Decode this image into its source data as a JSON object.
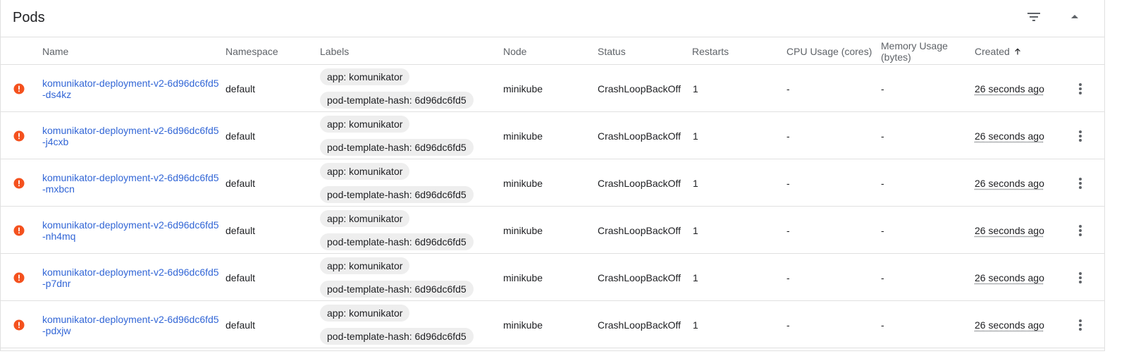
{
  "card": {
    "title": "Pods"
  },
  "header_icons": {
    "filter": "filter-list-icon",
    "collapse": "expand-less-icon"
  },
  "columns": {
    "name": "Name",
    "namespace": "Namespace",
    "labels": "Labels",
    "node": "Node",
    "status": "Status",
    "restarts": "Restarts",
    "cpu": "CPU Usage (cores)",
    "memory": "Memory Usage (bytes)",
    "created": "Created",
    "created_sort": "ascending"
  },
  "colors": {
    "error": "#f4511e",
    "link": "#3266d6",
    "chip_bg": "#eeeeee"
  },
  "rows": [
    {
      "status_icon": "error-icon",
      "name": "komunikator-deployment-v2-6d96dc6fd5-ds4kz",
      "namespace": "default",
      "labels": [
        "app: komunikator",
        "pod-template-hash: 6d96dc6fd5"
      ],
      "node": "minikube",
      "status": "CrashLoopBackOff",
      "restarts": "1",
      "cpu": "-",
      "memory": "-",
      "created": "26 seconds ago"
    },
    {
      "status_icon": "error-icon",
      "name": "komunikator-deployment-v2-6d96dc6fd5-j4cxb",
      "namespace": "default",
      "labels": [
        "app: komunikator",
        "pod-template-hash: 6d96dc6fd5"
      ],
      "node": "minikube",
      "status": "CrashLoopBackOff",
      "restarts": "1",
      "cpu": "-",
      "memory": "-",
      "created": "26 seconds ago"
    },
    {
      "status_icon": "error-icon",
      "name": "komunikator-deployment-v2-6d96dc6fd5-mxbcn",
      "namespace": "default",
      "labels": [
        "app: komunikator",
        "pod-template-hash: 6d96dc6fd5"
      ],
      "node": "minikube",
      "status": "CrashLoopBackOff",
      "restarts": "1",
      "cpu": "-",
      "memory": "-",
      "created": "26 seconds ago"
    },
    {
      "status_icon": "error-icon",
      "name": "komunikator-deployment-v2-6d96dc6fd5-nh4mq",
      "namespace": "default",
      "labels": [
        "app: komunikator",
        "pod-template-hash: 6d96dc6fd5"
      ],
      "node": "minikube",
      "status": "CrashLoopBackOff",
      "restarts": "1",
      "cpu": "-",
      "memory": "-",
      "created": "26 seconds ago"
    },
    {
      "status_icon": "error-icon",
      "name": "komunikator-deployment-v2-6d96dc6fd5-p7dnr",
      "namespace": "default",
      "labels": [
        "app: komunikator",
        "pod-template-hash: 6d96dc6fd5"
      ],
      "node": "minikube",
      "status": "CrashLoopBackOff",
      "restarts": "1",
      "cpu": "-",
      "memory": "-",
      "created": "26 seconds ago"
    },
    {
      "status_icon": "error-icon",
      "name": "komunikator-deployment-v2-6d96dc6fd5-pdxjw",
      "namespace": "default",
      "labels": [
        "app: komunikator",
        "pod-template-hash: 6d96dc6fd5"
      ],
      "node": "minikube",
      "status": "CrashLoopBackOff",
      "restarts": "1",
      "cpu": "-",
      "memory": "-",
      "created": "26 seconds ago"
    }
  ]
}
